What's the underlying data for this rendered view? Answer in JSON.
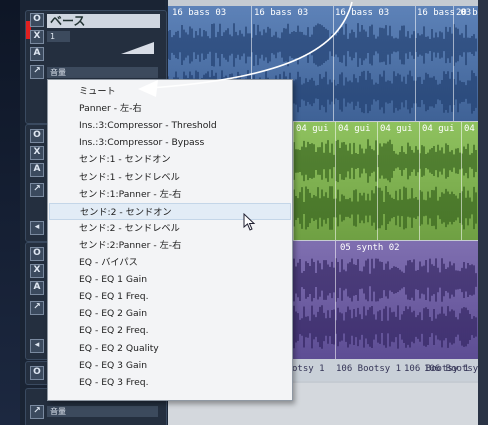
{
  "tracks": [
    {
      "name": "ベース",
      "sub_label": "音量",
      "buttons": [
        "O",
        "X",
        "A"
      ],
      "extra_button": "1"
    },
    {
      "name": "",
      "sub_label": "",
      "buttons": [
        "O",
        "X",
        "A"
      ]
    },
    {
      "name": "",
      "sub_label": "",
      "buttons": [
        "O",
        "X",
        "A"
      ]
    },
    {
      "name": "",
      "sub_label": "",
      "buttons": [
        "O"
      ]
    },
    {
      "name": "",
      "sub_label": "音量",
      "buttons": []
    }
  ],
  "timeline": {
    "bass_clips": [
      "16 bass 03",
      "16 bass 03",
      "16 bass 03",
      "16 bass 03",
      "20 ba"
    ],
    "guitar_clips": [
      "04 gui",
      "04 gui",
      "04 gui",
      "04 gui",
      "04 gui"
    ],
    "synth_clip": "05 synth 02",
    "bootsy_clips": [
      "otsy 1",
      "106 Bootsy 1",
      "106 Bootsy 1",
      "106 Bootsy"
    ],
    "colors": {
      "bass": "#4f74aa",
      "guitar": "#7cb04e",
      "synth": "#6e5ea3"
    }
  },
  "context_menu": {
    "items": [
      "ミュート",
      "Panner - 左-右",
      "Ins.:3:Compressor - Threshold",
      "Ins.:3:Compressor - Bypass",
      "センド:1 - センドオン",
      "センド:1 - センドレベル",
      "センド:1:Panner - 左-右",
      "センド:2 - センドオン",
      "センド:2 - センドレベル",
      "センド:2:Panner - 左-右",
      "EQ - バイパス",
      "EQ - EQ 1 Gain",
      "EQ - EQ 1 Freq.",
      "EQ - EQ 2 Gain",
      "EQ - EQ 2 Freq.",
      "EQ - EQ 2 Quality",
      "EQ - EQ 3 Gain",
      "EQ - EQ 3 Freq."
    ],
    "highlighted_index": 7
  }
}
